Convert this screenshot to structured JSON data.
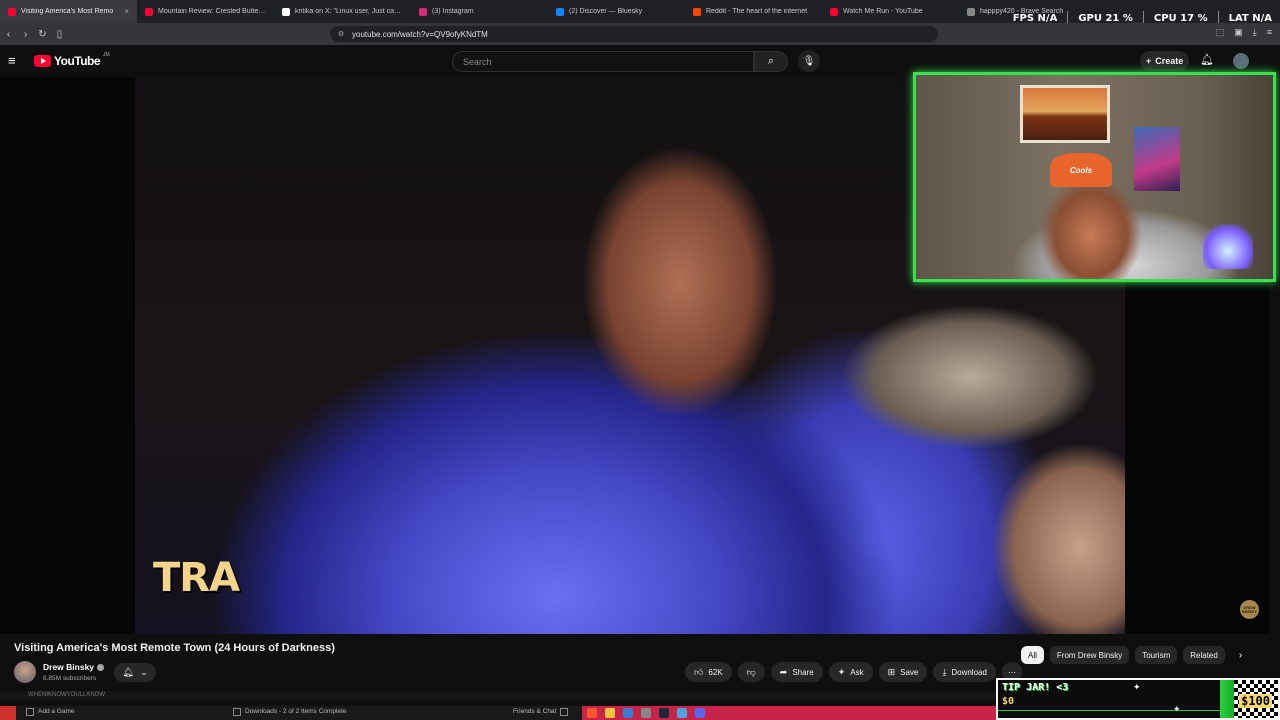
{
  "browser": {
    "tabs": [
      {
        "label": "Visiting America's Most Remo",
        "favicon_color": "#ff0033",
        "active": true
      },
      {
        "label": "Mountain Review: Crested Butte, Co",
        "favicon_color": "#ff0033",
        "active": false
      },
      {
        "label": "kritika on X: \"Linux user, Just came a",
        "favicon_color": "#ffffff",
        "active": false
      },
      {
        "label": "(3) Instagram",
        "favicon_color": "#d62976",
        "active": false
      },
      {
        "label": "(2) Discover — Bluesky",
        "favicon_color": "#1185fe",
        "active": false
      },
      {
        "label": "Reddit - The heart of the internet",
        "favicon_color": "#ff4500",
        "active": false
      },
      {
        "label": "Watch Me Run - YouTube",
        "favicon_color": "#ff0033",
        "active": false
      },
      {
        "label": "happpy420 - Brave Search",
        "favicon_color": "#888888",
        "active": false
      }
    ],
    "url": "youtube.com/watch?v=QV9ofyKNdTM"
  },
  "stats": {
    "fps_label": "FPS",
    "fps_value": "N/A",
    "gpu_label": "GPU",
    "gpu_value": "21 %",
    "cpu_label": "CPU",
    "cpu_value": "17 %",
    "lat_label": "LAT",
    "lat_value": "N/A"
  },
  "youtube": {
    "logo_text": "YouTube",
    "logo_region": "JM",
    "search_placeholder": "Search",
    "create_label": "Create"
  },
  "video": {
    "caption_text": "TRA",
    "watermark_text": "DREW BINSKY",
    "title": "Visiting America's Most Remote Town (24 Hours of Darkness)",
    "channel_name": "Drew Binsky",
    "subscribers": "6.85M subscribers",
    "likes": "62K",
    "share_label": "Share",
    "ask_label": "Ask",
    "save_label": "Save",
    "download_label": "Download"
  },
  "webcam": {
    "hat_text": "Cools"
  },
  "chips": [
    "All",
    "From Drew Binsky",
    "Tourism",
    "Related"
  ],
  "peek_text": "WHENIKNOWYOULLKNOW",
  "tipjar": {
    "label": "TIP JAR! <3",
    "current": "$0",
    "goal": "$100"
  },
  "taskbar": {
    "add_game": "Add a Game",
    "downloads": "Downloads - 2 of 2 Items Complete",
    "friends": "Friends & Chat"
  },
  "colors": {
    "webcam_border": "#38e04e",
    "yt_red": "#ff0033",
    "taskbar_accent": "#c8244a"
  }
}
